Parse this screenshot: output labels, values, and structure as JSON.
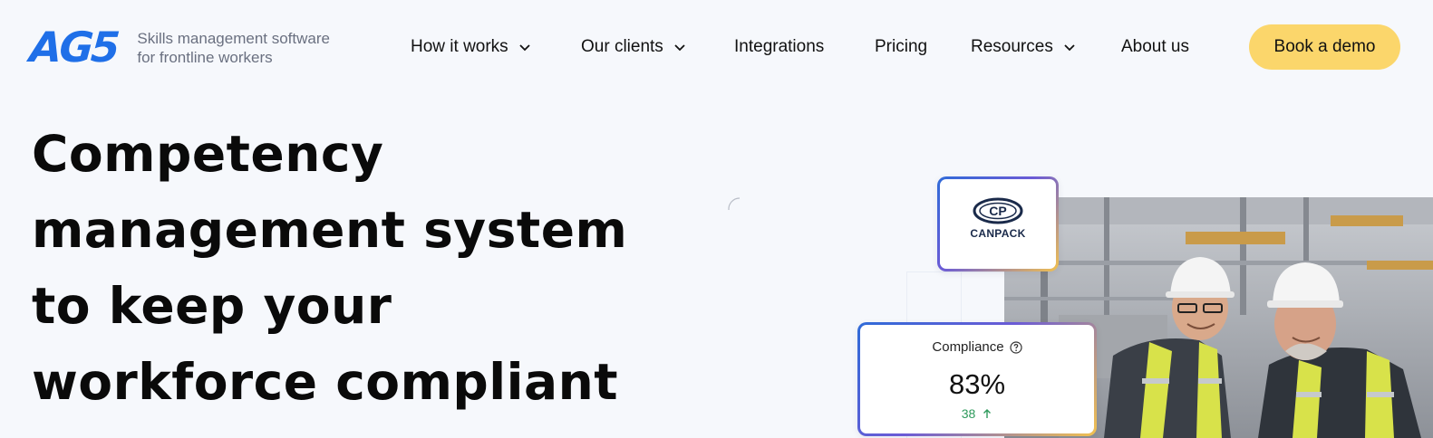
{
  "brand": {
    "logo_text": "AG5",
    "tagline_line1": "Skills management software",
    "tagline_line2": "for frontline workers",
    "accent_color": "#1f6fe8"
  },
  "nav": {
    "items": [
      {
        "label": "How it works",
        "has_dropdown": true,
        "icon": "chevron-down-icon"
      },
      {
        "label": "Our clients",
        "has_dropdown": true,
        "icon": "chevron-down-icon"
      },
      {
        "label": "Integrations",
        "has_dropdown": false
      },
      {
        "label": "Pricing",
        "has_dropdown": false
      },
      {
        "label": "Resources",
        "has_dropdown": true,
        "icon": "chevron-down-icon"
      },
      {
        "label": "About us",
        "has_dropdown": false
      }
    ],
    "cta_label": "Book a demo",
    "cta_color": "#fbd66b"
  },
  "hero": {
    "title_lines": [
      "Competency",
      "management system",
      "to keep your",
      "workforce compliant"
    ]
  },
  "client_card": {
    "logo_monogram": "CP",
    "logo_text": "CANPACK"
  },
  "compliance_card": {
    "label": "Compliance",
    "help_icon": "question-circle-icon",
    "value": "83%",
    "delta": "38",
    "delta_icon": "arrow-up-icon",
    "delta_color": "#2e9a5c"
  }
}
